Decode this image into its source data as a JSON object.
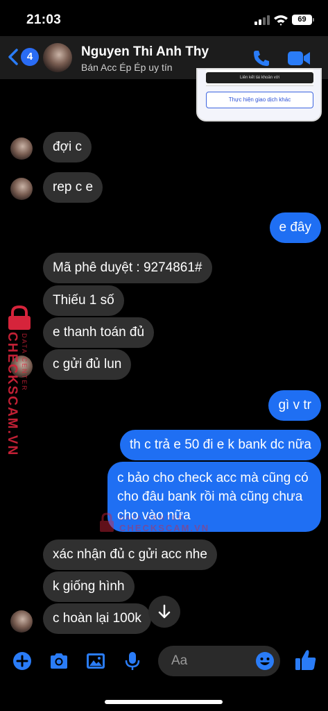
{
  "status": {
    "time": "21:03",
    "battery": "69"
  },
  "header": {
    "back_count": "4",
    "name": "Nguyen Thi Anh Thy",
    "subtitle": "Bán Acc Ép Ép uy tín"
  },
  "shared_image": {
    "strip_text": "Liên kết tài khoản với",
    "button_text": "Thực hiện giao dịch khác"
  },
  "messages": [
    {
      "from": "them",
      "text": "đợi c"
    },
    {
      "from": "them",
      "text": "rep c e"
    },
    {
      "from": "me",
      "text": "e đây"
    },
    {
      "from": "them",
      "text": "Mã phê duyệt : 9274861#"
    },
    {
      "from": "them",
      "text": "Thiếu 1 số"
    },
    {
      "from": "them",
      "text": "e thanh toán đủ"
    },
    {
      "from": "them",
      "text": "c gửi đủ lun"
    },
    {
      "from": "me",
      "text": "gì v tr"
    },
    {
      "from": "me",
      "text": "th c trả e 50 đi e k bank dc nữa"
    },
    {
      "from": "me",
      "text": "c bảo cho check acc mà cũng có cho đâu bank rồi mà cũng chưa cho vào nữa"
    },
    {
      "from": "them",
      "text": "xác nhận đủ c gửi acc nhe"
    },
    {
      "from": "them",
      "text": "k giống hình"
    },
    {
      "from": "them",
      "text": "c hoàn lại 100k"
    }
  ],
  "watermark": {
    "vertical_main": "CHECKSCAM.VN",
    "vertical_sub": "DATA CENTER",
    "center_top": "DATA CENTER",
    "center_main": "CHECKSCAM.VN"
  },
  "composer": {
    "placeholder": "Aa"
  },
  "colors": {
    "accent": "#1f6ff3",
    "incoming": "#303030",
    "watermark": "#d6243b"
  }
}
